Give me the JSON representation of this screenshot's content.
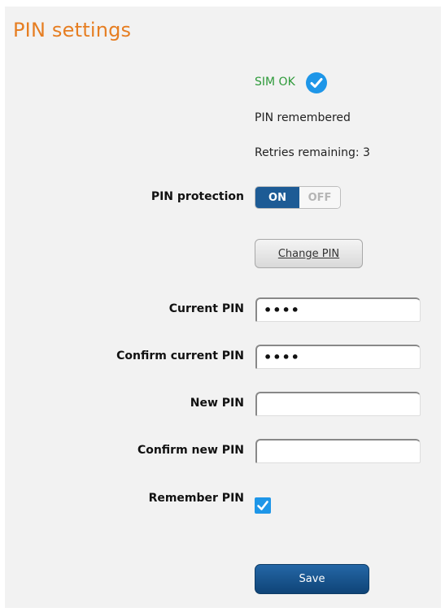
{
  "page": {
    "title": "PIN settings"
  },
  "status": {
    "sim": "SIM OK",
    "pin_state": "PIN remembered",
    "retries": "Retries remaining: 3"
  },
  "pin_protection": {
    "label": "PIN protection",
    "on": "ON",
    "off": "OFF",
    "value": "ON"
  },
  "change_pin": {
    "label": "Change PIN"
  },
  "fields": {
    "current_pin": {
      "label": "Current PIN",
      "value": "••••"
    },
    "confirm_current_pin": {
      "label": "Confirm current PIN",
      "value": "••••"
    },
    "new_pin": {
      "label": "New PIN",
      "value": ""
    },
    "confirm_new_pin": {
      "label": "Confirm new PIN",
      "value": ""
    }
  },
  "remember_pin": {
    "label": "Remember PIN",
    "checked": true
  },
  "save": {
    "label": "Save"
  },
  "colors": {
    "title": "#e67e22",
    "accent": "#1e96e8",
    "toggle_on": "#1d5b95",
    "ok_text": "#2e9a3a"
  }
}
